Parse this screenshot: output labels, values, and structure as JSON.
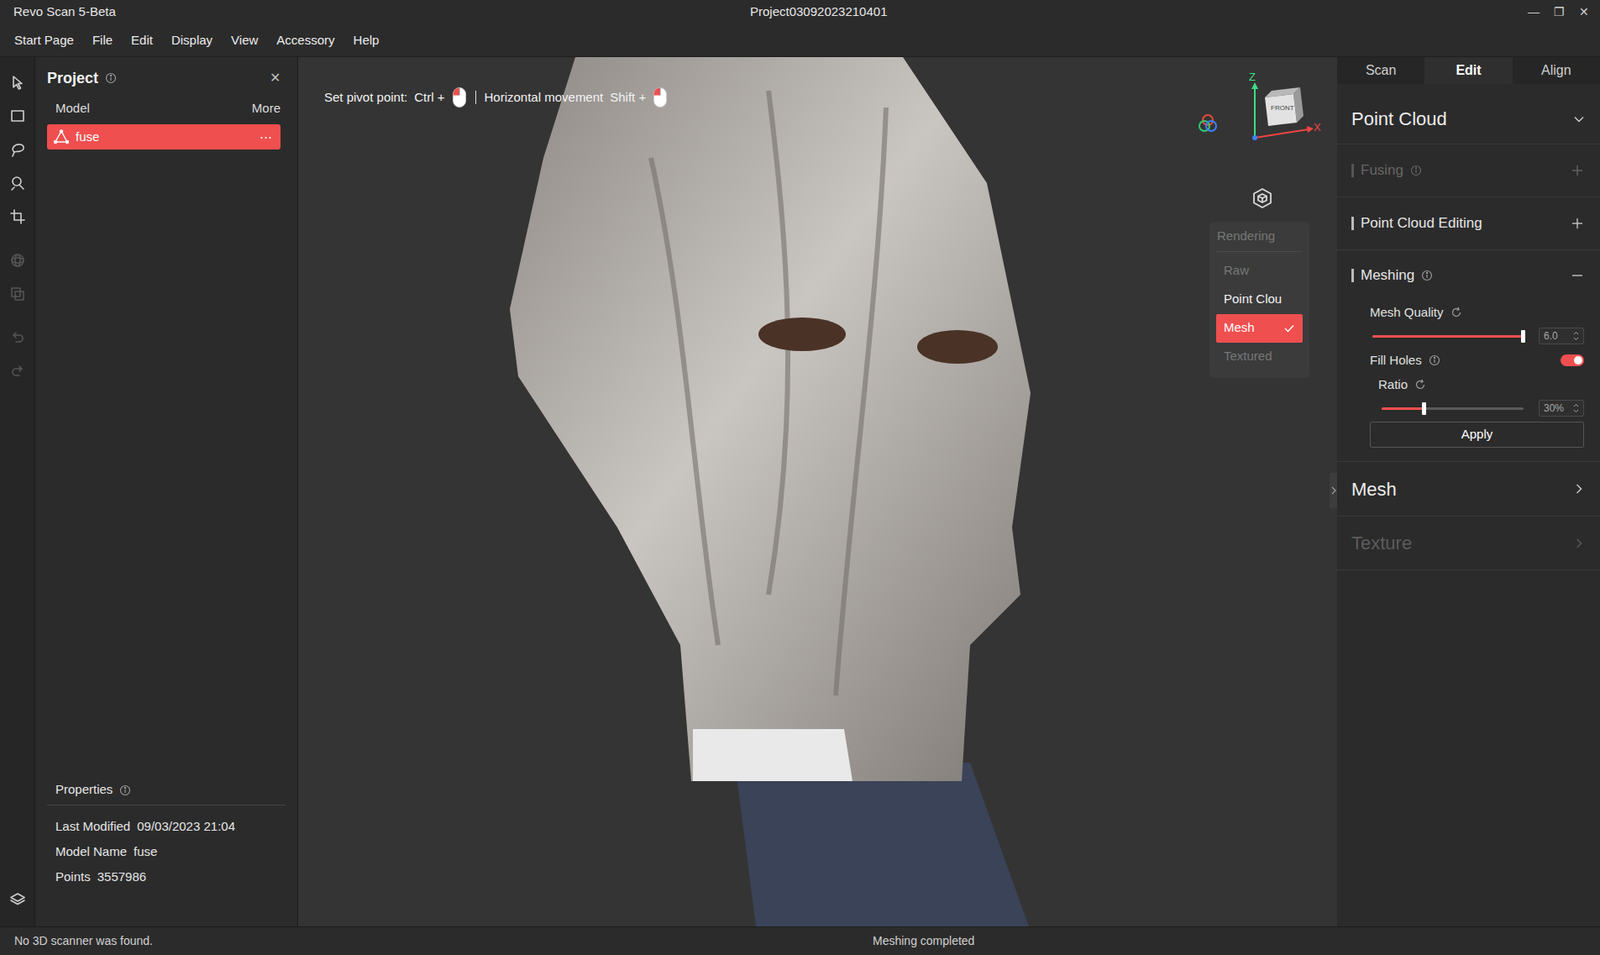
{
  "window": {
    "title": "Revo Scan 5-Beta",
    "project": "Project03092023210401",
    "controls": [
      "—",
      "❐",
      "✕"
    ]
  },
  "menu": [
    "Start Page",
    "File",
    "Edit",
    "Display",
    "View",
    "Accessory",
    "Help"
  ],
  "tools": [
    {
      "kind": "select",
      "disabled": false
    },
    {
      "kind": "rect",
      "disabled": false
    },
    {
      "kind": "lasso",
      "disabled": false
    },
    {
      "kind": "brush",
      "disabled": false
    },
    {
      "kind": "crop",
      "disabled": false
    },
    {
      "kind": "sphere",
      "disabled": true
    },
    {
      "kind": "copy",
      "disabled": true
    },
    {
      "kind": "undo",
      "disabled": true
    },
    {
      "kind": "redo",
      "disabled": true
    }
  ],
  "project": {
    "title": "Project",
    "close": "✕",
    "columns": [
      "Model",
      "More"
    ],
    "models": [
      {
        "name": "fuse",
        "more": "⋯",
        "selected": true
      }
    ],
    "properties": {
      "title": "Properties",
      "rows": [
        {
          "label": "Last Modified",
          "value": "09/03/2023 21:04"
        },
        {
          "label": "Model Name",
          "value": "fuse"
        },
        {
          "label": "Points",
          "value": "3557986"
        }
      ]
    }
  },
  "viewport": {
    "hints": [
      {
        "label": "Set pivot point:",
        "key": "Ctrl +"
      },
      {
        "label": "Horizontal movement",
        "key": "Shift +"
      }
    ],
    "axes": {
      "z": "Z",
      "x": "X",
      "face": "FRONT"
    },
    "rendering": {
      "title": "Rendering",
      "options": [
        {
          "label": "Raw",
          "selected": false,
          "disabled": true
        },
        {
          "label": "Point Clou",
          "selected": false,
          "disabled": false
        },
        {
          "label": "Mesh",
          "selected": true,
          "disabled": false
        },
        {
          "label": "Textured",
          "selected": false,
          "disabled": true
        }
      ]
    }
  },
  "panel": {
    "tabs": [
      {
        "label": "Scan",
        "selected": false
      },
      {
        "label": "Edit",
        "selected": true
      },
      {
        "label": "Align",
        "selected": false
      }
    ],
    "sections": [
      {
        "title": "Point Cloud",
        "expanded": true,
        "disabled": false,
        "groups": [
          {
            "title": "Fusing",
            "info": true,
            "disabled": true,
            "expanded": false
          },
          {
            "title": "Point Cloud Editing",
            "info": false,
            "disabled": false,
            "expanded": false
          },
          {
            "title": "Meshing",
            "info": true,
            "disabled": false,
            "expanded": true,
            "button": "Apply",
            "controls": [
              {
                "kind": "slider",
                "label": "Mesh Quality",
                "level": 1.0,
                "reading": "6.0"
              },
              {
                "kind": "toggle",
                "label": "Fill Holes",
                "on": true
              },
              {
                "kind": "subslider",
                "label": "Ratio",
                "level": 0.3,
                "reading": "30%"
              }
            ]
          }
        ]
      },
      {
        "title": "Mesh",
        "expanded": false,
        "disabled": false
      },
      {
        "title": "Texture",
        "expanded": false,
        "disabled": true
      }
    ]
  },
  "status_bar": {
    "left": "No 3D scanner was found.",
    "center": "Meshing completed"
  }
}
